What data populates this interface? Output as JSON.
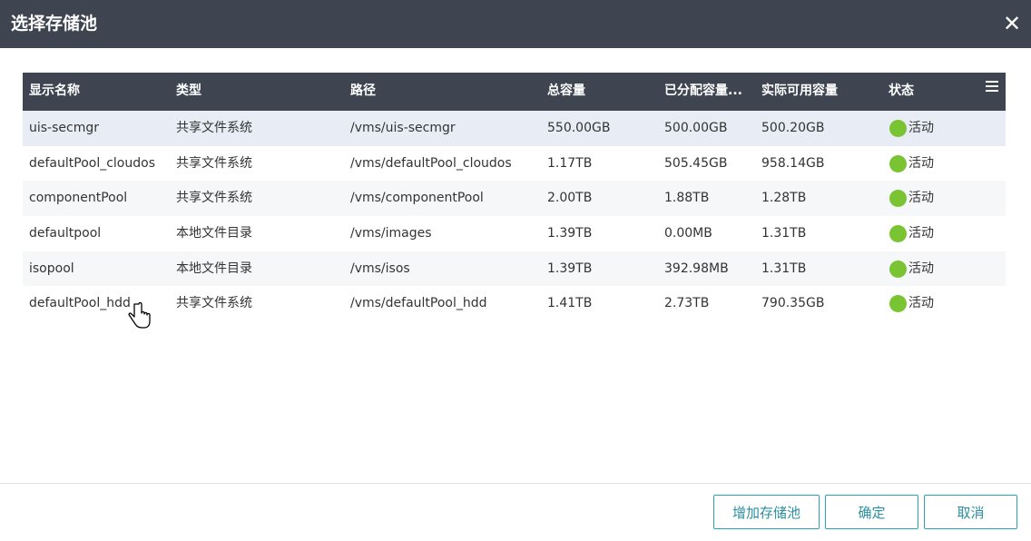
{
  "dialog": {
    "title": "选择存储池",
    "close_icon": "close-icon"
  },
  "table": {
    "columns": [
      "显示名称",
      "类型",
      "路径",
      "总容量",
      "已分配容量...",
      "实际可用容量",
      "状态"
    ],
    "menu_icon": "menu-icon",
    "status_color": "#7ac332",
    "rows": [
      {
        "name": "uis-secmgr",
        "type": "共享文件系统",
        "path": "/vms/uis-secmgr",
        "total": "550.00GB",
        "allocated": "500.00GB",
        "available": "500.20GB",
        "status": "活动",
        "selected": true
      },
      {
        "name": "defaultPool_cloudos",
        "type": "共享文件系统",
        "path": "/vms/defaultPool_cloudos",
        "total": "1.17TB",
        "allocated": "505.45GB",
        "available": "958.14GB",
        "status": "活动"
      },
      {
        "name": "componentPool",
        "type": "共享文件系统",
        "path": "/vms/componentPool",
        "total": "2.00TB",
        "allocated": "1.88TB",
        "available": "1.28TB",
        "status": "活动"
      },
      {
        "name": "defaultpool",
        "type": "本地文件目录",
        "path": "/vms/images",
        "total": "1.39TB",
        "allocated": "0.00MB",
        "available": "1.31TB",
        "status": "活动"
      },
      {
        "name": "isopool",
        "type": "本地文件目录",
        "path": "/vms/isos",
        "total": "1.39TB",
        "allocated": "392.98MB",
        "available": "1.31TB",
        "status": "活动"
      },
      {
        "name": "defaultPool_hdd",
        "type": "共享文件系统",
        "path": "/vms/defaultPool_hdd",
        "total": "1.41TB",
        "allocated": "2.73TB",
        "available": "790.35GB",
        "status": "活动"
      }
    ]
  },
  "footer": {
    "add_label": "增加存储池",
    "ok_label": "确定",
    "cancel_label": "取消"
  },
  "colors": {
    "header_bg": "#3e4450",
    "button_accent": "#2aa3b3"
  }
}
